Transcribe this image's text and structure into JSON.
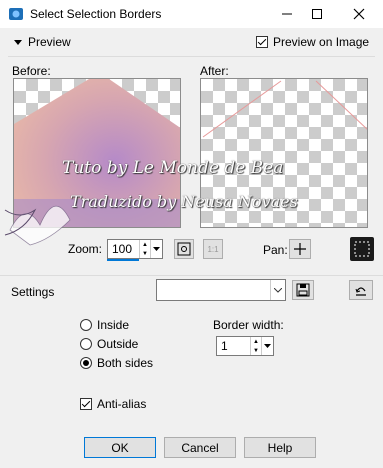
{
  "window": {
    "title": "Select Selection Borders"
  },
  "preview": {
    "label": "Preview",
    "preview_on_image_label": "Preview on Image",
    "preview_on_image": true
  },
  "panes": {
    "before_label": "Before:",
    "after_label": "After:"
  },
  "zoom": {
    "label": "Zoom:",
    "value": "100",
    "one_to_one_label": "1:1"
  },
  "pan": {
    "label": "Pan:"
  },
  "watermark": {
    "line1": "Tuto by Le Monde de Bea",
    "line2": "Traduzido by Neusa Novaes"
  },
  "settings": {
    "label": "Settings",
    "preset_value": ""
  },
  "selection_options": {
    "options": [
      {
        "label": "Inside",
        "selected": false
      },
      {
        "label": "Outside",
        "selected": false
      },
      {
        "label": "Both sides",
        "selected": true
      }
    ]
  },
  "border": {
    "label": "Border width:",
    "value": "1"
  },
  "antialias": {
    "label": "Anti-alias",
    "checked": true
  },
  "buttons": {
    "ok": "OK",
    "cancel": "Cancel",
    "help": "Help"
  }
}
